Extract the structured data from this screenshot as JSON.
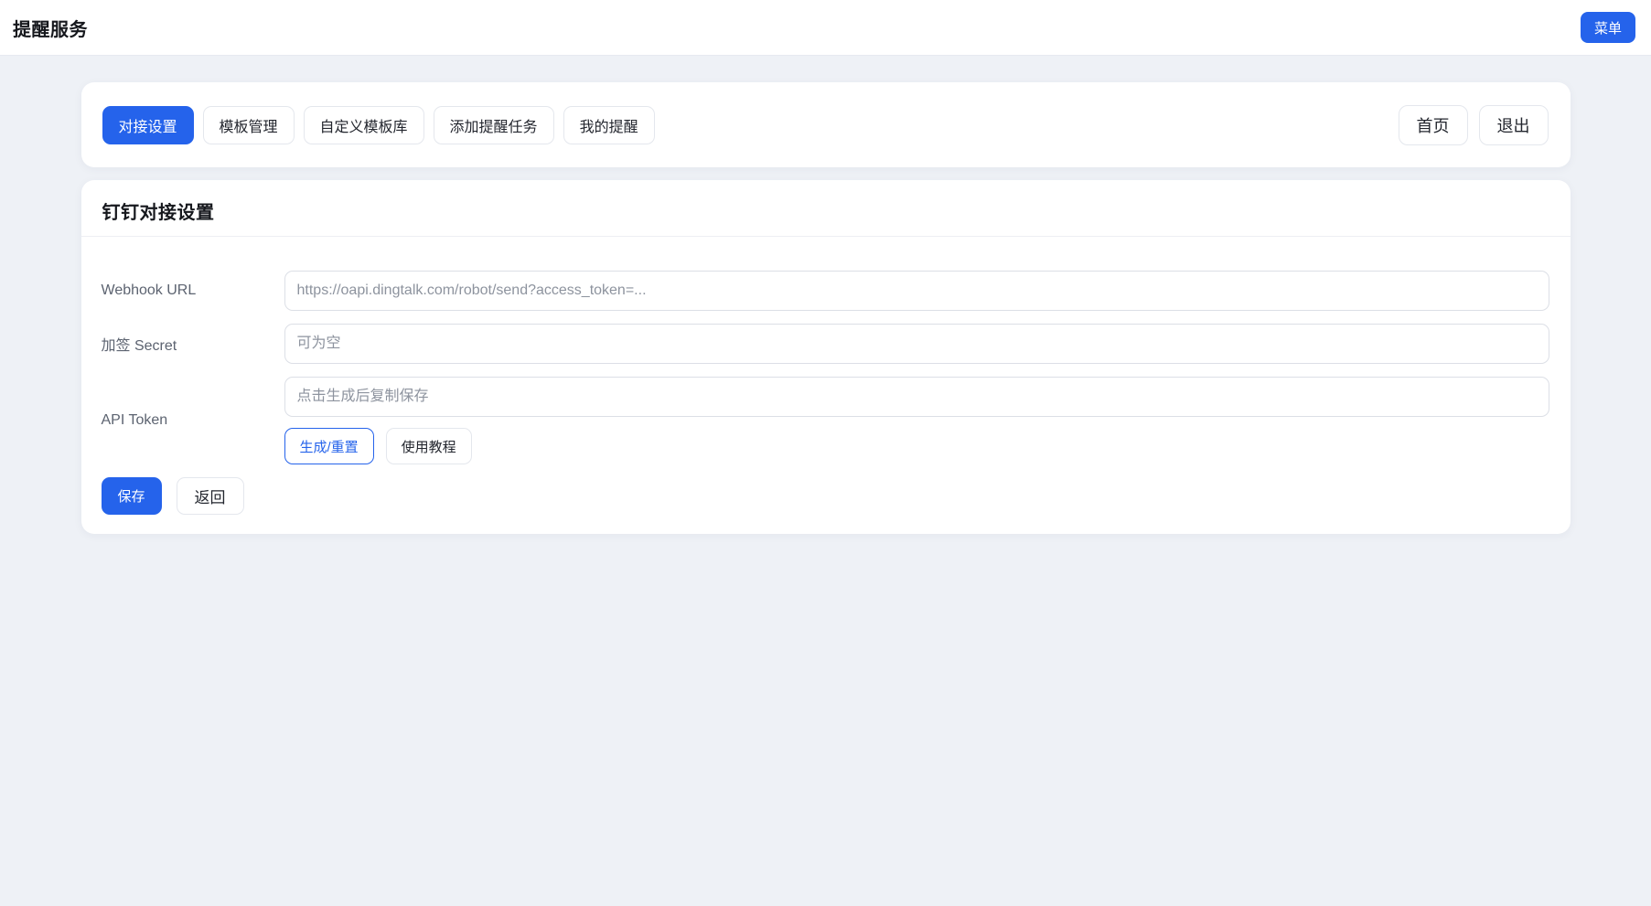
{
  "topbar": {
    "title": "提醒服务",
    "menu_button": "菜单"
  },
  "nav": {
    "tabs": [
      {
        "label": "对接设置",
        "active": true
      },
      {
        "label": "模板管理",
        "active": false
      },
      {
        "label": "自定义模板库",
        "active": false
      },
      {
        "label": "添加提醒任务",
        "active": false
      },
      {
        "label": "我的提醒",
        "active": false
      }
    ],
    "home_button": "首页",
    "logout_button": "退出"
  },
  "settings_card": {
    "title": "钉钉对接设置",
    "fields": [
      {
        "label": "Webhook URL",
        "value": "",
        "placeholder": "https://oapi.dingtalk.com/robot/send?access_token=..."
      },
      {
        "label": "加签 Secret",
        "value": "",
        "placeholder": "可为空"
      },
      {
        "label": "API Token",
        "value": "",
        "placeholder": "点击生成后复制保存"
      }
    ],
    "token_buttons": {
      "generate": "生成/重置",
      "tutorial": "使用教程"
    },
    "actions": {
      "save": "保存",
      "back": "返回"
    }
  },
  "colors": {
    "primary": "#2563eb",
    "page_background": "#eef1f6",
    "card_background": "#ffffff"
  }
}
